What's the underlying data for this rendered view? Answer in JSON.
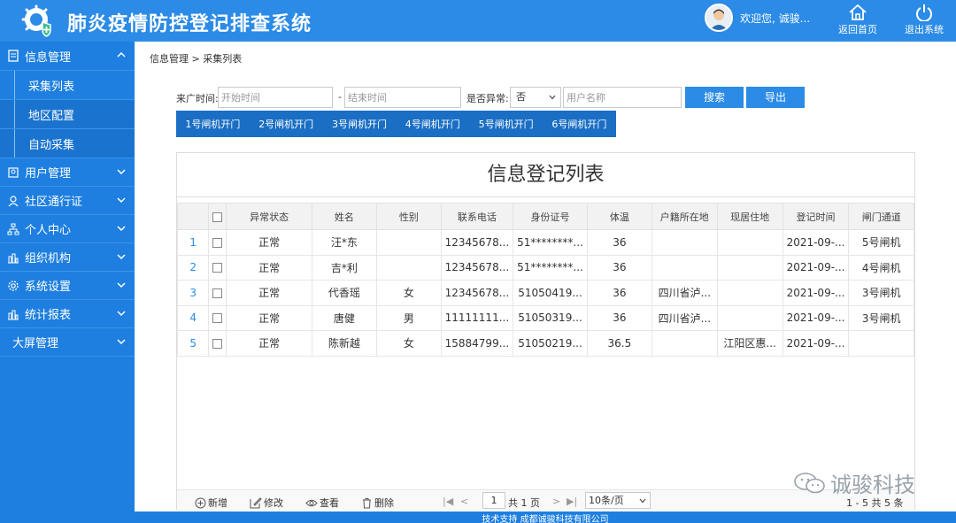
{
  "header": {
    "title": "肺炎疫情防控登记排查系统",
    "welcome": "欢迎您, 诚骏...",
    "home_label": "返回首页",
    "exit_label": "退出系统"
  },
  "sidebar": {
    "groups": [
      {
        "label": "信息管理",
        "icon": "document-icon",
        "expanded": true
      },
      {
        "label": "用户管理",
        "icon": "users-icon"
      },
      {
        "label": "社区通行证",
        "icon": "person-icon"
      },
      {
        "label": "个人中心",
        "icon": "sitemap-icon"
      },
      {
        "label": "组织机构",
        "icon": "bar-chart-icon"
      },
      {
        "label": "系统设置",
        "icon": "gear-icon"
      },
      {
        "label": "统计报表",
        "icon": "bar-chart-icon"
      },
      {
        "label": "大屏管理",
        "icon": ""
      }
    ],
    "sub_items": [
      "采集列表",
      "地区配置",
      "自动采集"
    ]
  },
  "breadcrumb": "信息管理 > 采集列表",
  "filters": {
    "time_label": "来广时间:",
    "start_placeholder": "开始时间",
    "dash": "-",
    "end_placeholder": "结束时间",
    "abnormal_label": "是否异常:",
    "abnormal_value": "否",
    "username_placeholder": "用户名称",
    "search_label": "搜索",
    "export_label": "导出"
  },
  "gates": [
    "1号闸机开门",
    "2号闸机开门",
    "3号闸机开门",
    "4号闸机开门",
    "5号闸机开门",
    "6号闸机开门"
  ],
  "panel_title": "信息登记列表",
  "table": {
    "columns": [
      "异常状态",
      "姓名",
      "性别",
      "联系电话",
      "身份证号",
      "体温",
      "户籍所在地",
      "现居住地",
      "登记时间",
      "闸门通道"
    ],
    "rows": [
      {
        "n": "1",
        "status": "正常",
        "name": "汪*东",
        "gender": "",
        "phone": "12345678...",
        "id": "51********...",
        "temp": "36",
        "hukou": "",
        "residence": "",
        "time": "2021-09-...",
        "gate": "5号闸机"
      },
      {
        "n": "2",
        "status": "正常",
        "name": "吉*利",
        "gender": "",
        "phone": "12345678...",
        "id": "51********...",
        "temp": "36",
        "hukou": "",
        "residence": "",
        "time": "2021-09-...",
        "gate": "4号闸机"
      },
      {
        "n": "3",
        "status": "正常",
        "name": "代香瑶",
        "gender": "女",
        "phone": "12345678...",
        "id": "51050419...",
        "temp": "36",
        "hukou": "四川省泸...",
        "residence": "",
        "time": "2021-09-...",
        "gate": "3号闸机"
      },
      {
        "n": "4",
        "status": "正常",
        "name": "唐健",
        "gender": "男",
        "phone": "11111111...",
        "id": "51050319...",
        "temp": "36",
        "hukou": "四川省泸...",
        "residence": "",
        "time": "2021-09-...",
        "gate": "3号闸机"
      },
      {
        "n": "5",
        "status": "正常",
        "name": "陈新越",
        "gender": "女",
        "phone": "15884799...",
        "id": "51050219...",
        "temp": "36.5",
        "hukou": "",
        "residence": "江阳区惠...",
        "time": "2021-09-...",
        "gate": ""
      }
    ]
  },
  "toolbar": {
    "add": "新增",
    "edit": "修改",
    "view": "查看",
    "delete": "删除"
  },
  "pager": {
    "page": "1",
    "total_pages": "共 1 页",
    "per_page": "10条/页",
    "summary": "1 - 5  共 5 条"
  },
  "watermark": "诚骏科技",
  "footer": "技术支持 成都诚骏科技有限公司"
}
